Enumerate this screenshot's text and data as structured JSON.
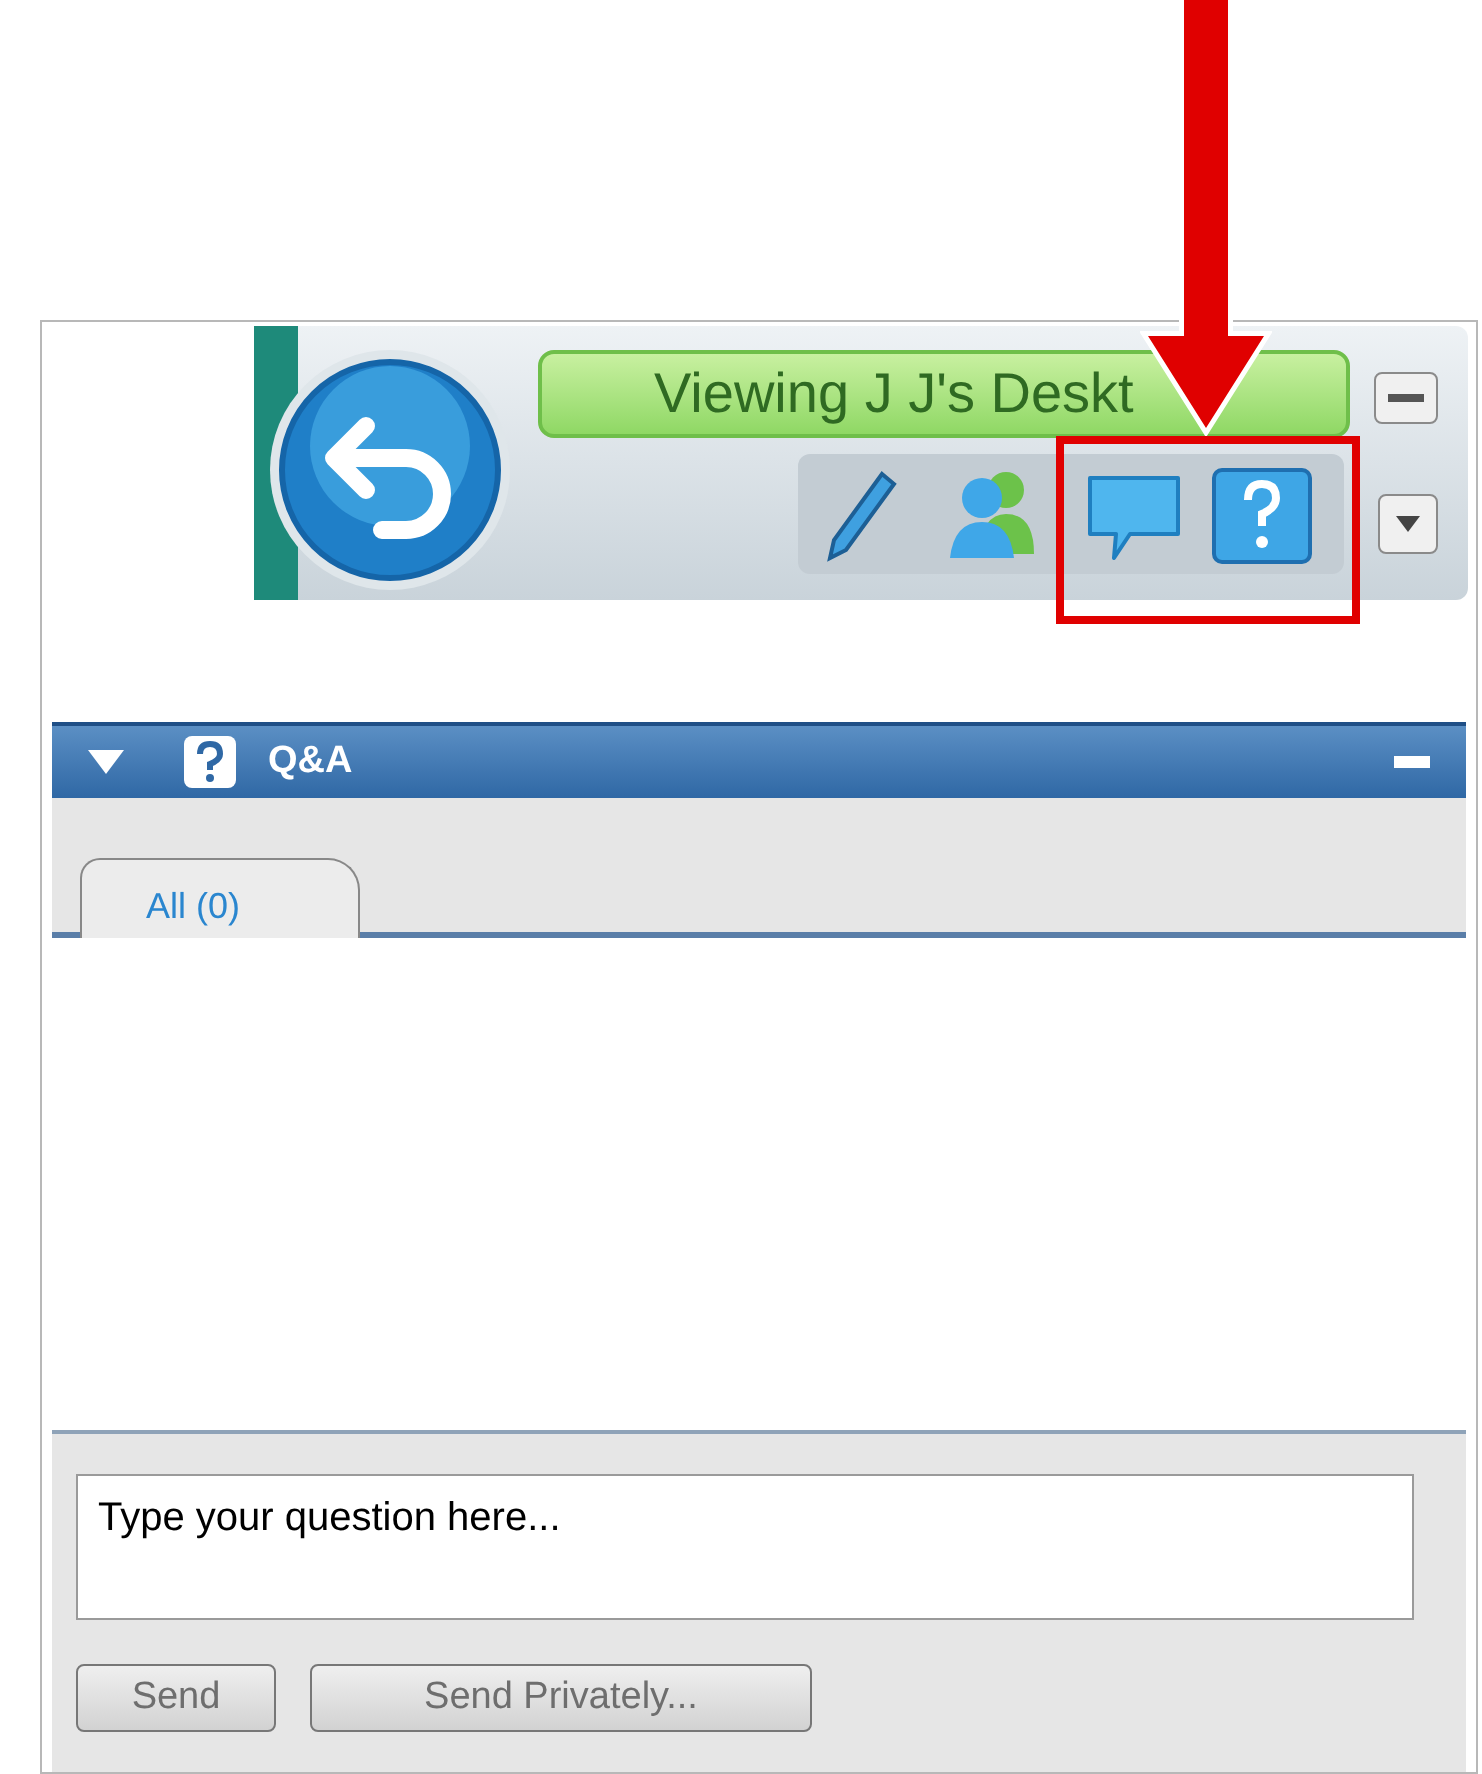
{
  "toolbar": {
    "status": "Viewing J J's Deskt"
  },
  "panel": {
    "title": "Q&A",
    "expanded": true,
    "tabs": [
      {
        "label": "All (0)",
        "selected": true
      }
    ],
    "question": {
      "placeholder": "Type your question here..."
    },
    "buttons": [
      {
        "label": "Send",
        "disabled": true
      },
      {
        "label": "Send Privately...",
        "disabled": true
      }
    ]
  }
}
